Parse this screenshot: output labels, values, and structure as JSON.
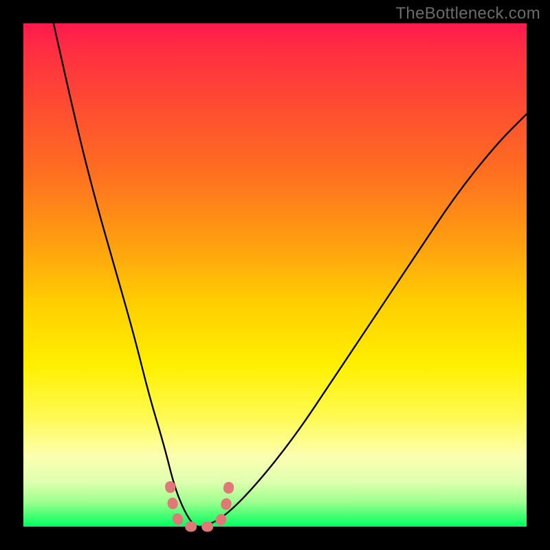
{
  "watermark": "TheBottleneck.com",
  "chart_data": {
    "type": "line",
    "title": "",
    "xlabel": "",
    "ylabel": "",
    "xlim": [
      0,
      100
    ],
    "ylim": [
      0,
      100
    ],
    "grid": false,
    "legend": false,
    "series": [
      {
        "name": "bottleneck-curve",
        "x": [
          6,
          10,
          14,
          18,
          22,
          25,
          28,
          30,
          32,
          34,
          36,
          40,
          46,
          54,
          62,
          70,
          78,
          86,
          94,
          100
        ],
        "values": [
          100,
          82,
          66,
          52,
          38,
          26,
          16,
          8,
          3,
          0,
          0,
          2,
          8,
          18,
          30,
          42,
          54,
          66,
          76,
          82
        ]
      }
    ],
    "annotations": [
      {
        "name": "minimum-marker",
        "x_range": [
          30,
          40
        ],
        "value": 0,
        "color": "#e07878"
      }
    ],
    "background": "rainbow-vertical"
  }
}
